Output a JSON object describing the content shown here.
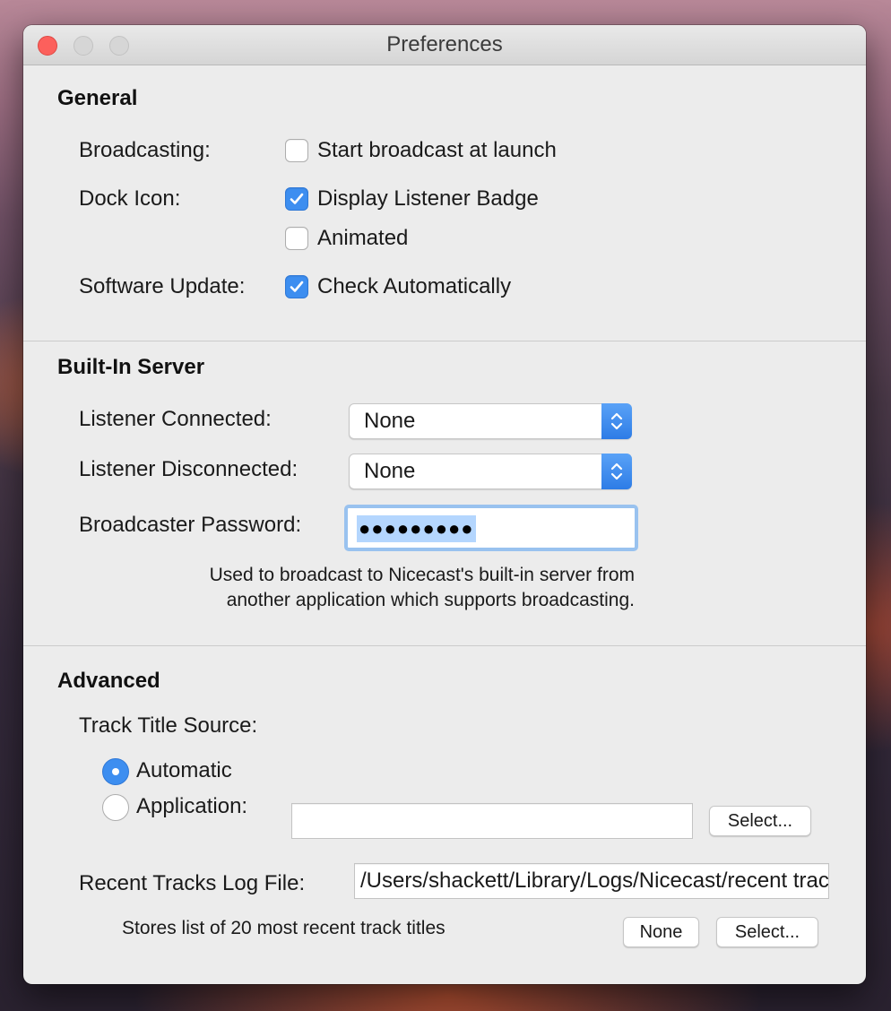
{
  "window": {
    "title": "Preferences"
  },
  "general": {
    "heading": "General",
    "broadcasting_label": "Broadcasting:",
    "start_broadcast_label": "Start broadcast at launch",
    "start_broadcast_checked": false,
    "dock_icon_label": "Dock Icon:",
    "listener_badge_label": "Display Listener Badge",
    "listener_badge_checked": true,
    "animated_label": "Animated",
    "animated_checked": false,
    "software_update_label": "Software Update:",
    "check_auto_label": "Check Automatically",
    "check_auto_checked": true
  },
  "server": {
    "heading": "Built-In Server",
    "listener_connected_label": "Listener Connected:",
    "listener_connected_value": "None",
    "listener_disconnected_label": "Listener Disconnected:",
    "listener_disconnected_value": "None",
    "password_label": "Broadcaster Password:",
    "password_value": "●●●●●●●●●",
    "note_line1": "Used to broadcast to Nicecast's built-in server from",
    "note_line2": "another application which supports broadcasting."
  },
  "advanced": {
    "heading": "Advanced",
    "track_title_source_label": "Track Title Source:",
    "automatic_label": "Automatic",
    "application_label": "Application:",
    "selected_source": "Automatic",
    "application_value": "",
    "select_app_button": "Select...",
    "log_file_label": "Recent Tracks Log File:",
    "log_file_value": "/Users/shackett/Library/Logs/Nicecast/recent tracks.txt",
    "log_note": "Stores list of 20 most recent track titles",
    "none_button": "None",
    "select_log_button": "Select..."
  },
  "colors": {
    "accent": "#3d8ef0",
    "close": "#fc605c",
    "selection": "#b4d6fe"
  }
}
